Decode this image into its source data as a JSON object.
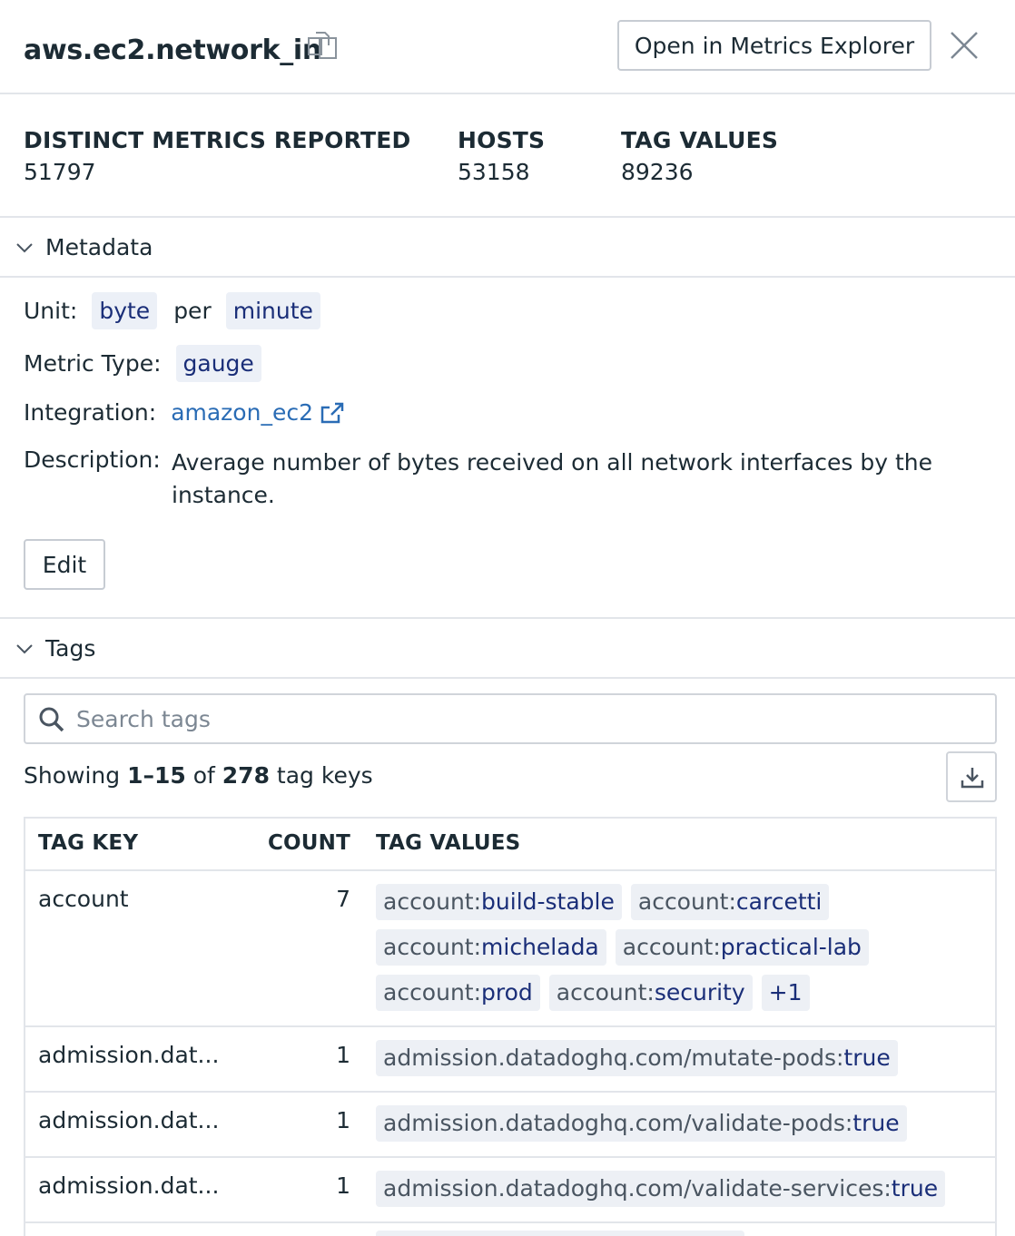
{
  "header": {
    "title": "aws.ec2.network_in",
    "open_button": "Open in Metrics Explorer"
  },
  "stats": [
    {
      "label": "DISTINCT METRICS REPORTED",
      "value": "51797"
    },
    {
      "label": "HOSTS",
      "value": "53158"
    },
    {
      "label": "TAG VALUES",
      "value": "89236"
    }
  ],
  "metadata": {
    "section_label": "Metadata",
    "unit_label": "Unit:",
    "unit_value": "byte",
    "unit_per": "per",
    "unit_per_value": "minute",
    "type_label": "Metric Type:",
    "type_value": "gauge",
    "integration_label": "Integration:",
    "integration_value": "amazon_ec2",
    "description_label": "Description:",
    "description_value": "Average number of bytes received on all network interfaces by the instance.",
    "edit_button": "Edit"
  },
  "tags": {
    "section_label": "Tags",
    "search_placeholder": "Search tags",
    "showing_prefix": "Showing",
    "showing_range": "1–15",
    "showing_of": "of",
    "showing_total": "278",
    "showing_suffix": "tag keys",
    "columns": {
      "key": "TAG KEY",
      "count": "COUNT",
      "values": "TAG VALUES"
    },
    "rows": [
      {
        "key": "account",
        "count": "7",
        "values": [
          {
            "k": "account:",
            "v": "build-stable"
          },
          {
            "k": "account:",
            "v": "carcetti"
          },
          {
            "k": "account:",
            "v": "michelada"
          },
          {
            "k": "account:",
            "v": "practical-lab"
          },
          {
            "k": "account:",
            "v": "prod"
          },
          {
            "k": "account:",
            "v": "security"
          }
        ],
        "more": "+1"
      },
      {
        "key": "admission.dat...",
        "count": "1",
        "values": [
          {
            "k": "admission.datadoghq.com/mutate-pods:",
            "v": "true"
          }
        ]
      },
      {
        "key": "admission.dat...",
        "count": "1",
        "values": [
          {
            "k": "admission.datadoghq.com/validate-pods:",
            "v": "true"
          }
        ]
      },
      {
        "key": "admission.dat...",
        "count": "1",
        "values": [
          {
            "k": "admission.datadoghq.com/validate-services:",
            "v": "true"
          }
        ]
      }
    ]
  }
}
